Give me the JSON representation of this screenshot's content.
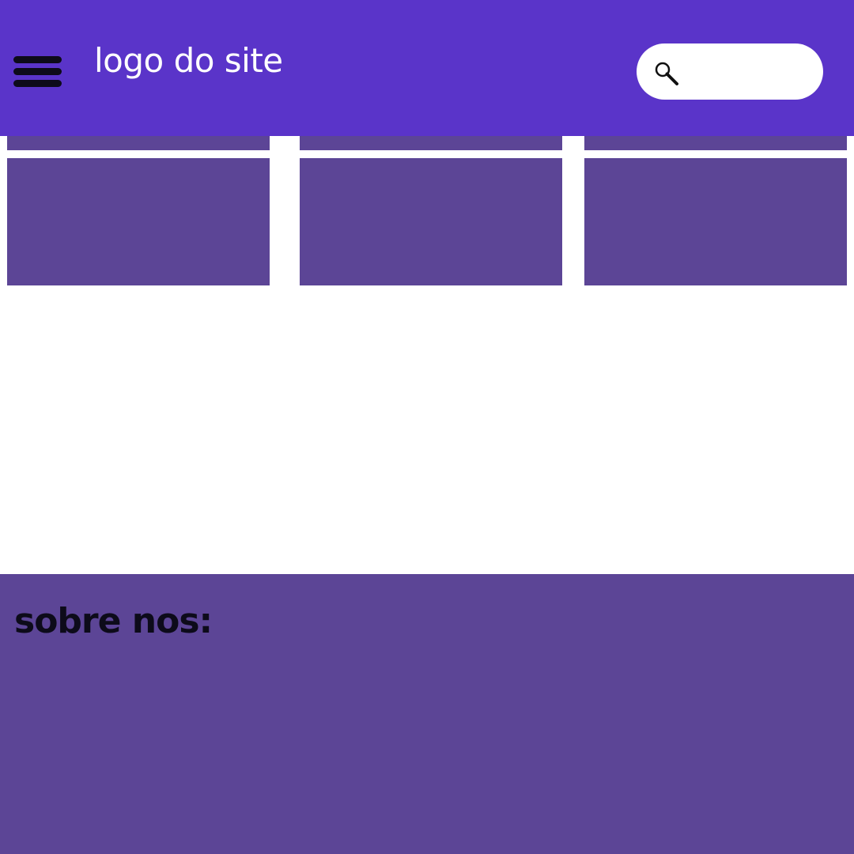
{
  "colors": {
    "header_bg": "#5a34c9",
    "card_bg": "#5c4596",
    "footer_bg": "#5c4596",
    "logo_text": "#ffffff",
    "footer_text": "#0d0b1a"
  },
  "header": {
    "menu_icon": "hamburger-menu-icon",
    "logo_text": "logo do site",
    "search": {
      "icon": "search-icon",
      "value": "",
      "placeholder": ""
    }
  },
  "cards": [
    {
      "id": "card-1"
    },
    {
      "id": "card-2"
    },
    {
      "id": "card-3"
    }
  ],
  "footer": {
    "title": "sobre nos:"
  }
}
